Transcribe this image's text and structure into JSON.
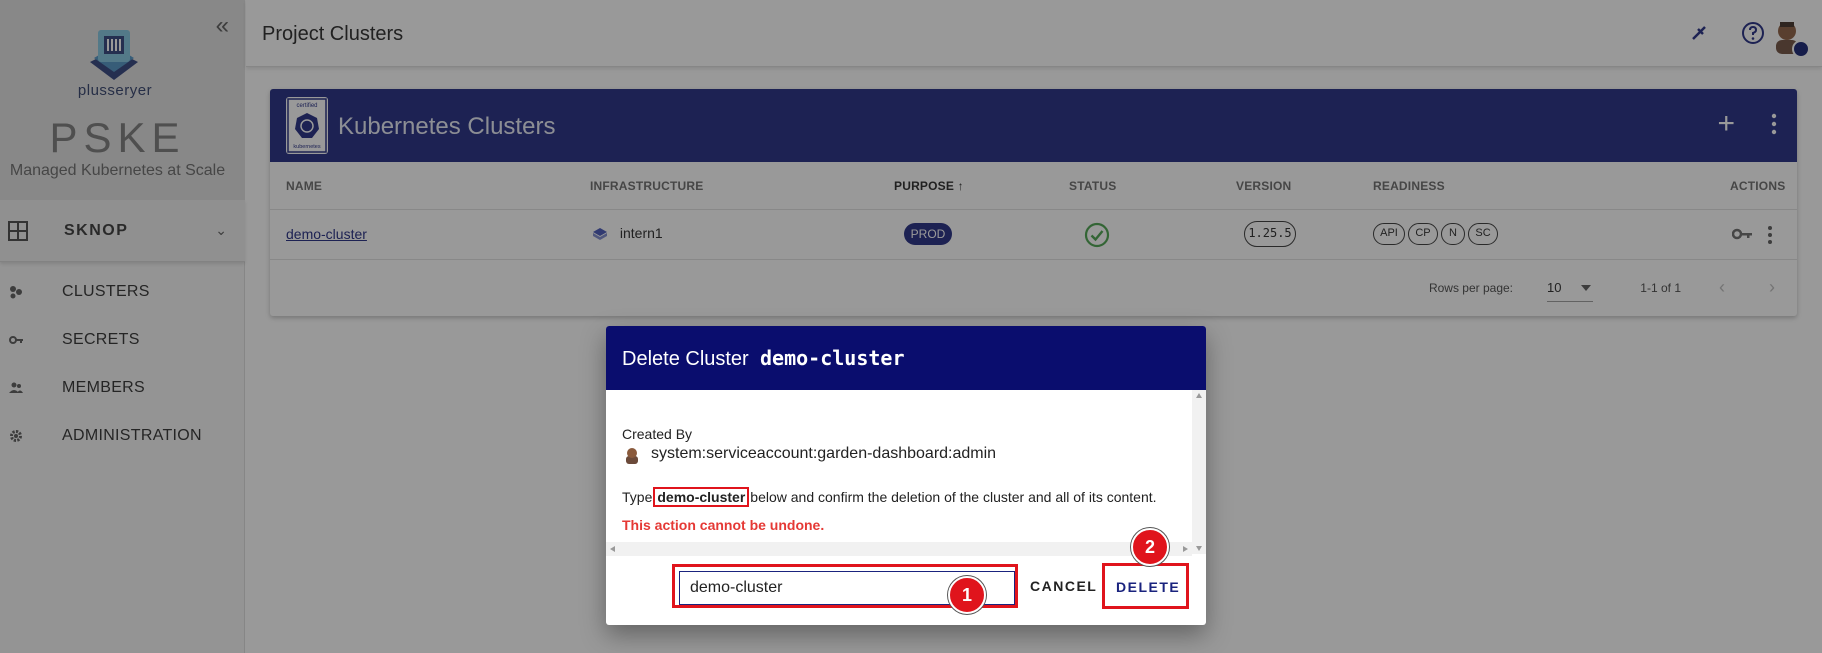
{
  "sidebar": {
    "brand": "plusseryer",
    "product": "PSKE",
    "tagline": "Managed Kubernetes at Scale",
    "project": "SKNOP",
    "nav": [
      {
        "label": "CLUSTERS",
        "icon": "clusters-icon"
      },
      {
        "label": "SECRETS",
        "icon": "key-icon"
      },
      {
        "label": "MEMBERS",
        "icon": "members-icon"
      },
      {
        "label": "ADMINISTRATION",
        "icon": "gear-icon"
      }
    ]
  },
  "topbar": {
    "title": "Project Clusters"
  },
  "card": {
    "title": "Kubernetes Clusters",
    "badge_text_top": "certified",
    "badge_text_bottom": "kubernetes",
    "columns": {
      "name": "NAME",
      "infrastructure": "INFRASTRUCTURE",
      "purpose": "PURPOSE",
      "status": "STATUS",
      "version": "VERSION",
      "readiness": "READINESS",
      "actions": "ACTIONS"
    },
    "rows": [
      {
        "name": "demo-cluster",
        "infrastructure": "intern1",
        "purpose": "PROD",
        "version": "1.25.5",
        "readiness": [
          "API",
          "CP",
          "N",
          "SC"
        ]
      }
    ],
    "footer": {
      "rows_per_page_label": "Rows per page:",
      "rows_per_page": "10",
      "page_info": "1-1 of 1"
    }
  },
  "dialog": {
    "title": "Delete Cluster",
    "cluster_name": "demo-cluster",
    "created_by_label": "Created By",
    "created_by": "system:serviceaccount:garden-dashboard:admin",
    "instruction_prefix": "Type",
    "instruction_name": "demo-cluster",
    "instruction_suffix": "below and confirm the deletion of the cluster and all of its content.",
    "warning": "This action cannot be undone.",
    "input_value": "demo-cluster",
    "cancel_label": "CANCEL",
    "delete_label": "DELETE"
  },
  "markers": {
    "step1": "1",
    "step2": "2"
  },
  "colors": {
    "primary": "#1a237e",
    "dialog_header": "#0a0d6e",
    "warning": "#e53935",
    "highlight": "#e0141c",
    "status_ok": "#43a047"
  }
}
